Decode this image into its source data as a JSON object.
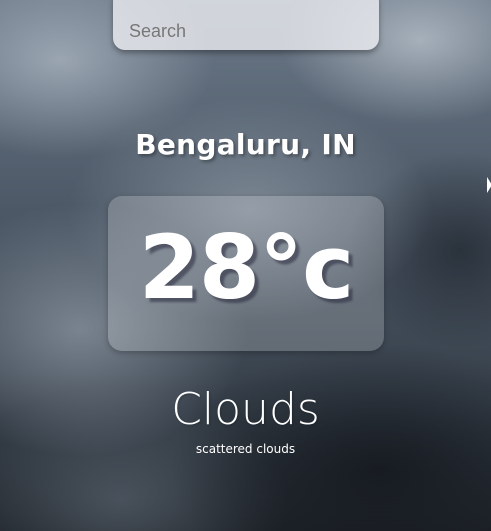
{
  "search": {
    "placeholder": "Search",
    "value": ""
  },
  "weather": {
    "location": "Bengaluru, IN",
    "temperature": "28°c",
    "condition": "Clouds",
    "description": "scattered clouds"
  },
  "background": {
    "theme": "cloudy-sky",
    "colors": {
      "light": "#6b7887",
      "mid": "#4c5866",
      "dark": "#1e2329"
    }
  }
}
